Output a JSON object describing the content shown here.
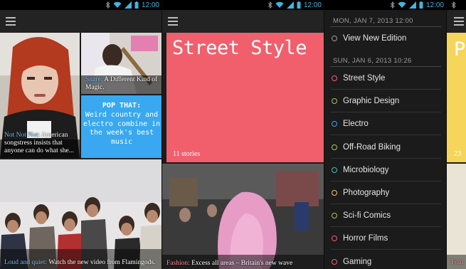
{
  "status": {
    "time": "12:00"
  },
  "screen1": {
    "tiles": [
      {
        "tag": "Not Not Not:",
        "text": " American songstress insists that anyone can do what she..."
      },
      {
        "tag": "Snare:",
        "text": " A Different Kind of Magic."
      },
      {
        "tag": "Loud and quiet:",
        "text": " Watch the new video from Flamingods."
      }
    ],
    "pop": {
      "title": "POP THAT:",
      "body": "Weird country and electro combine in the week's best music"
    }
  },
  "screen2": {
    "hero": {
      "title": "Street Style",
      "count": "11 stories"
    },
    "photo_caption": {
      "tag": "Fashion:",
      "text": " Excess all areas – Britain's new wave"
    }
  },
  "screen3": {
    "date1": "MON, JAN 7, 2013 12:00",
    "edition_item": "View New Edition",
    "date2": "SUN, JAN 6, 2013 10:26",
    "items": [
      {
        "label": "Street Style",
        "color": "#f15f6c"
      },
      {
        "label": "Graphic Design",
        "color": "#a8c64a"
      },
      {
        "label": "Electro",
        "color": "#39a8f0"
      },
      {
        "label": "Off-Road Biking",
        "color": "#a8c64a"
      },
      {
        "label": "Microbiology",
        "color": "#3fc2b8"
      },
      {
        "label": "Photography",
        "color": "#f0c85a"
      },
      {
        "label": "Sci-fi Comics",
        "color": "#a8c64a"
      },
      {
        "label": "Horror Films",
        "color": "#f15f6c"
      },
      {
        "label": "Gaming",
        "color": "#f15f6c"
      }
    ]
  },
  "screen4": {
    "peek_count": "23",
    "peek_caption": "Foto"
  }
}
